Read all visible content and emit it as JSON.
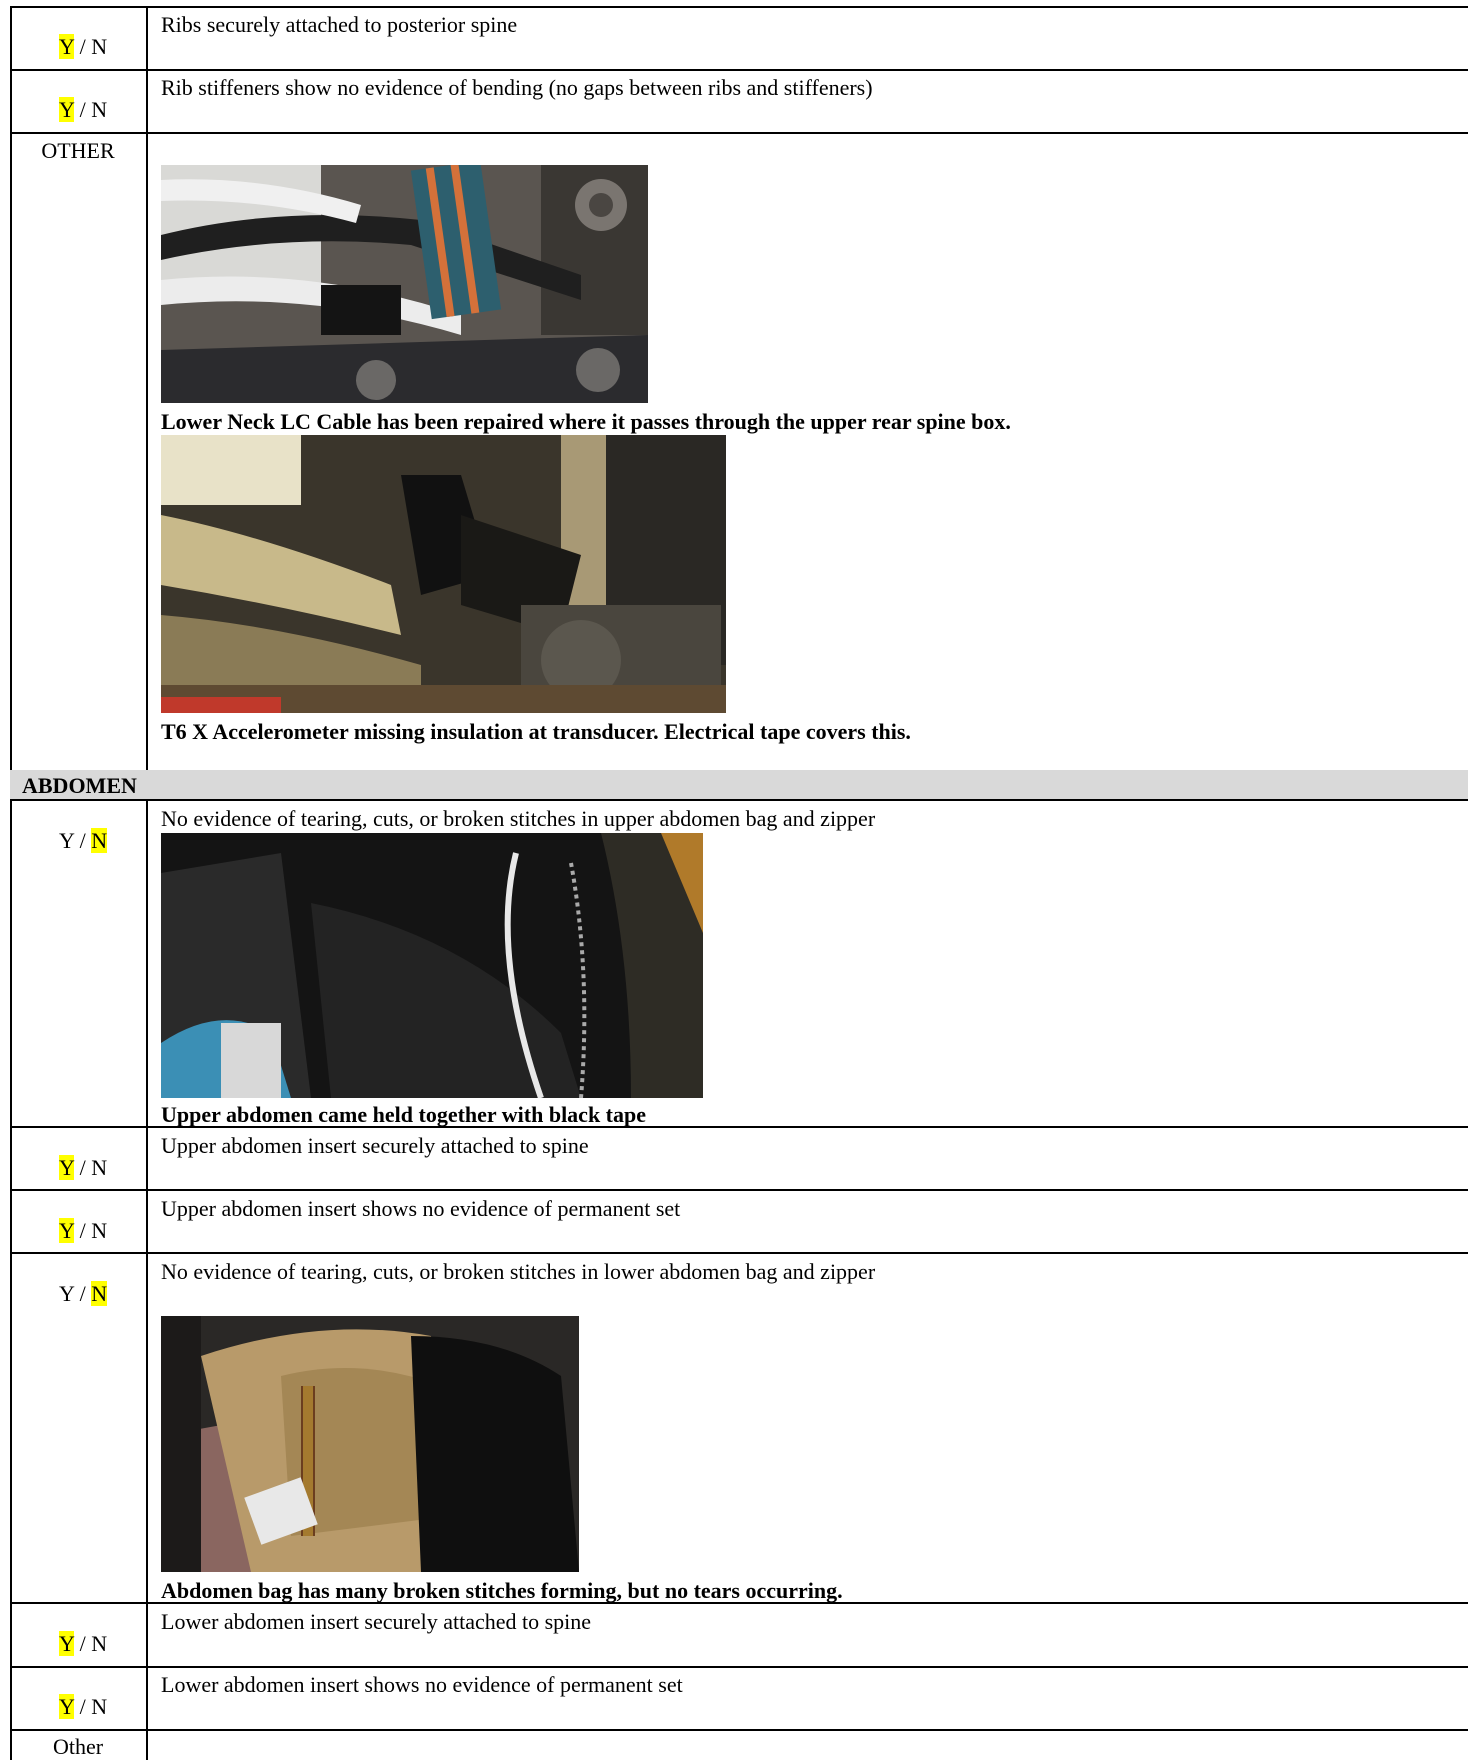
{
  "rows": {
    "ribs_attached": {
      "yn": {
        "y": "Y",
        "sep": " / ",
        "n": "N",
        "selected": "Y"
      },
      "label": "Ribs securely attached to posterior spine"
    },
    "rib_stiffeners": {
      "yn": {
        "y": "Y",
        "sep": " / ",
        "n": "N",
        "selected": "Y"
      },
      "label": "Rib stiffeners show no evidence of bending (no gaps between ribs and stiffeners)"
    },
    "other_thorax": {
      "label": "OTHER",
      "photo1_caption": "Lower Neck LC Cable has been repaired where it passes through the upper rear spine box.",
      "photo2_caption": "T6 X Accelerometer missing insulation at transducer. Electrical tape covers this."
    },
    "abdomen_header": "ABDOMEN",
    "upper_bag": {
      "yn": {
        "y": "Y",
        "sep": " / ",
        "n": "N",
        "selected": "N"
      },
      "label": "No evidence of tearing, cuts, or broken stitches in upper abdomen bag and zipper",
      "caption": "Upper abdomen came held together with black tape"
    },
    "upper_insert_attached": {
      "yn": {
        "y": "Y",
        "sep": " / ",
        "n": "N",
        "selected": "Y"
      },
      "label": "Upper abdomen insert securely attached to spine"
    },
    "upper_insert_set": {
      "yn": {
        "y": "Y",
        "sep": " / ",
        "n": "N",
        "selected": "Y"
      },
      "label": "Upper abdomen insert shows no evidence of permanent set"
    },
    "lower_bag": {
      "yn": {
        "y": "Y",
        "sep": " / ",
        "n": "N",
        "selected": "N"
      },
      "label": "No evidence of tearing, cuts, or broken stitches in lower abdomen bag and zipper",
      "caption": "Abdomen bag has many broken stitches forming, but no tears occurring."
    },
    "lower_insert_attached": {
      "yn": {
        "y": "Y",
        "sep": " / ",
        "n": "N",
        "selected": "Y"
      },
      "label": "Lower abdomen insert securely attached to spine"
    },
    "lower_insert_set": {
      "yn": {
        "y": "Y",
        "sep": " / ",
        "n": "N",
        "selected": "Y"
      },
      "label": "Lower abdomen insert shows no evidence of permanent set"
    },
    "other_abdomen": {
      "label": "Other"
    }
  },
  "colors": {
    "highlight": "#ffff00",
    "section_bar": "#d9d9d9",
    "border": "#000000"
  }
}
